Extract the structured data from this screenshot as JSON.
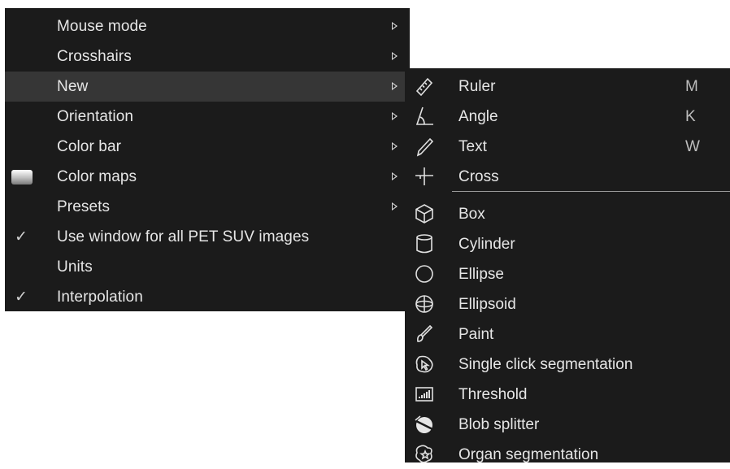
{
  "main_menu": {
    "items": [
      {
        "label": "Mouse mode",
        "submenu": true
      },
      {
        "label": "Crosshairs",
        "submenu": true
      },
      {
        "label": "New",
        "submenu": true,
        "highlighted": true
      },
      {
        "label": "Orientation",
        "submenu": true
      },
      {
        "label": "Color bar",
        "submenu": true
      },
      {
        "label": "Color maps",
        "submenu": true,
        "icon": "gradient-swatch-icon"
      },
      {
        "label": "Presets",
        "submenu": true
      },
      {
        "label": "Use window for all PET SUV images",
        "checked": true
      },
      {
        "label": "Units"
      },
      {
        "label": "Interpolation",
        "checked": true
      }
    ],
    "check_glyph": "✓"
  },
  "sub_menu": {
    "items": [
      {
        "label": "Ruler",
        "shortcut": "M",
        "icon": "ruler-icon"
      },
      {
        "label": "Angle",
        "shortcut": "K",
        "icon": "angle-icon"
      },
      {
        "label": "Text",
        "shortcut": "W",
        "icon": "pencil-icon"
      },
      {
        "label": "Cross",
        "icon": "cross-icon"
      },
      {
        "label": "Box",
        "icon": "cube-icon"
      },
      {
        "label": "Cylinder",
        "icon": "cylinder-icon"
      },
      {
        "label": "Ellipse",
        "icon": "circle-icon"
      },
      {
        "label": "Ellipsoid",
        "icon": "sphere-icon"
      },
      {
        "label": "Paint",
        "icon": "brush-icon"
      },
      {
        "label": "Single click segmentation",
        "icon": "click-segmentation-icon"
      },
      {
        "label": "Threshold",
        "icon": "threshold-icon"
      },
      {
        "label": "Blob splitter",
        "icon": "blob-splitter-icon"
      },
      {
        "label": "Organ segmentation",
        "icon": "organ-segmentation-icon"
      }
    ]
  },
  "colors": {
    "menu_bg": "#1b1b1b",
    "highlight_bg": "#363636",
    "text": "#e6e6e6"
  }
}
